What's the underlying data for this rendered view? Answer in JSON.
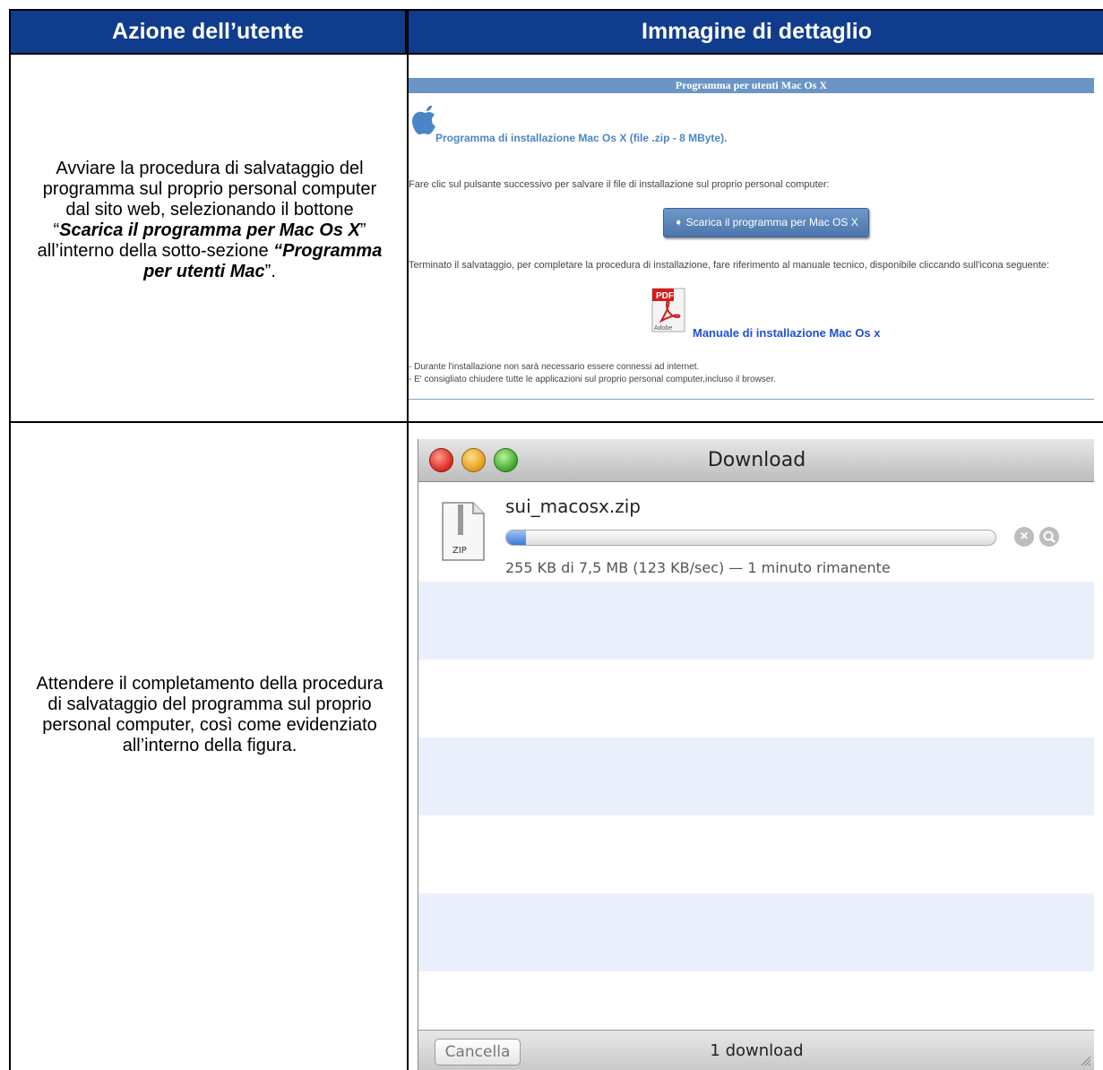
{
  "table": {
    "header_left": "Azione dell’utente",
    "header_right": "Immagine di dettaglio"
  },
  "row1": {
    "action": {
      "p1": "Avviare la procedura di salvataggio del programma sul proprio personal computer dal sito web, selezionando il bottone “",
      "b1": "Scarica il programma per Mac Os X",
      "p2": "” all’interno della sotto-sezione ",
      "b2": "“Programma per utenti Mac",
      "p3": "”."
    },
    "web": {
      "section_title": "Programma per utenti Mac Os X",
      "installer_link": "Programma di installazione Mac Os X (file .zip - 8 MByte).",
      "instruction": "Fare clic sul pulsante successivo per salvare il file di installazione sul proprio personal computer:",
      "download_button": "➧ Scarica il programma per Mac OS X",
      "after_save": "Terminato il salvataggio, per completare la procedura di installazione, fare riferimento al manuale tecnico, disponibile cliccando sull'icona seguente:",
      "pdf_label": "PDF",
      "adobe_label": "Adobe",
      "manual_link": "Manuale di installazione Mac Os x",
      "note1": "- Durante l'installazione non sarà necessario essere connessi ad internet.",
      "note2": "- E' consigliato chiudere tutte le applicazioni sul proprio personal computer,incluso il browser."
    }
  },
  "row2": {
    "action": "Attendere il completamento della procedura di salvataggio del programma sul proprio personal computer, così come evidenziato all’interno della figura.",
    "window": {
      "title": "Download",
      "file_name": "sui_macosx.zip",
      "zip_label": "ZIP",
      "progress_fraction": 0.04,
      "status": "255 KB di 7,5 MB (123 KB/sec) — 1 minuto rimanente",
      "clear_button": "Cancella",
      "count": "1 download"
    }
  }
}
